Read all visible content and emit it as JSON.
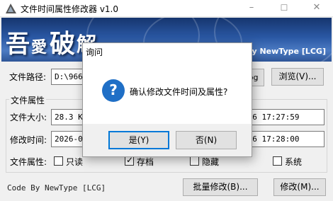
{
  "window": {
    "title": "文件时间属性修改器 v1.0",
    "min_glyph": "–",
    "max_glyph": "☐",
    "close_glyph": "✕"
  },
  "banner": {
    "logo_chars": [
      "吾",
      "愛",
      "破",
      "解"
    ],
    "credit": "Code By NewType [LCG]"
  },
  "path_row": {
    "label": "文件路径:",
    "value": "D:\\96632",
    "ext_fragment": "jpg",
    "browse_label": "浏览(V)..."
  },
  "group": {
    "title": "文件属性",
    "size_label": "文件大小:",
    "size_value": "28.3 KB",
    "created_time": "-26 17:27:59",
    "modified_label": "修改时间:",
    "modified_value": "2026-01",
    "modified_time": "-26 17:28:00",
    "attr_label": "文件属性:",
    "attributes": [
      {
        "label": "只读",
        "checked": false
      },
      {
        "label": "存档",
        "checked": true
      },
      {
        "label": "隐藏",
        "checked": false
      },
      {
        "label": "系统",
        "checked": false
      }
    ]
  },
  "footer": {
    "credit": "Code By NewType [LCG]",
    "batch_label": "批量修改(B)...",
    "modify_label": "修改(M)..."
  },
  "dialog": {
    "title": "询问",
    "close_glyph": "✕",
    "icon_glyph": "?",
    "message": "确认修改文件时间及属性?",
    "yes_label": "是(Y)",
    "no_label": "否(N)"
  },
  "colors": {
    "accent": "#0078d7",
    "question_icon": "#1f6fc6",
    "banner_dark": "#16356e",
    "banner_light": "#4c7bc3"
  }
}
